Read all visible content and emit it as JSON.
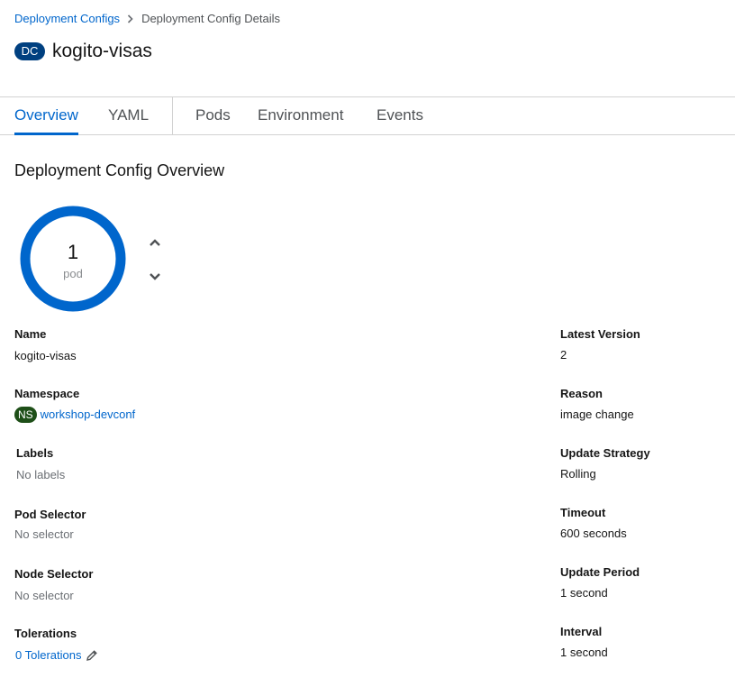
{
  "breadcrumb": {
    "parent": "Deployment Configs",
    "current": "Deployment Config Details"
  },
  "header": {
    "kind_badge": "DC",
    "title": "kogito-visas"
  },
  "tabs": [
    {
      "label": "Overview",
      "active": true
    },
    {
      "label": "YAML",
      "active": false
    },
    {
      "label": "Pods",
      "active": false
    },
    {
      "label": "Environment",
      "active": false
    },
    {
      "label": "Events",
      "active": false
    }
  ],
  "overview": {
    "section_title": "Deployment Config Overview",
    "pod_count": "1",
    "pod_label": "pod"
  },
  "left_fields": {
    "name": {
      "label": "Name",
      "value": "kogito-visas"
    },
    "namespace": {
      "label": "Namespace",
      "badge": "NS",
      "value": "workshop-devconf"
    },
    "labels": {
      "label": "Labels",
      "value": "No labels"
    },
    "pod_selector": {
      "label": "Pod Selector",
      "value": "No selector"
    },
    "node_selector": {
      "label": "Node Selector",
      "value": "No selector"
    },
    "tolerations": {
      "label": "Tolerations",
      "value": "0 Tolerations"
    }
  },
  "right_fields": {
    "latest_version": {
      "label": "Latest Version",
      "value": "2"
    },
    "reason": {
      "label": "Reason",
      "value": "image change"
    },
    "update_strategy": {
      "label": "Update Strategy",
      "value": "Rolling"
    },
    "timeout": {
      "label": "Timeout",
      "value": "600 seconds"
    },
    "update_period": {
      "label": "Update Period",
      "value": "1 second"
    },
    "interval": {
      "label": "Interval",
      "value": "1 second"
    }
  },
  "colors": {
    "link": "#0066cc",
    "dc_badge": "#004080",
    "ns_badge": "#1e4f18",
    "donut": "#0066cc"
  },
  "icons": {
    "breadcrumb_separator": "chevron-right-icon",
    "scale_up": "angle-up-icon",
    "scale_down": "angle-down-icon",
    "edit": "pencil-icon"
  }
}
